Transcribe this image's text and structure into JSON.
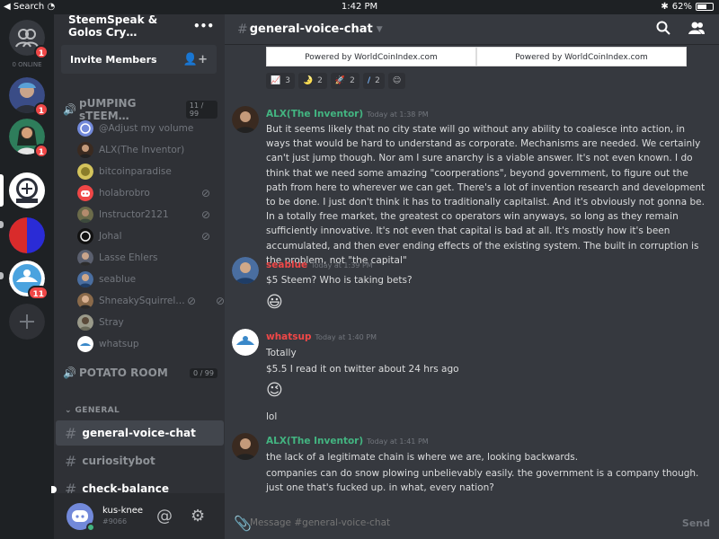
{
  "statusbar": {
    "left": "Search",
    "time": "1:42 PM",
    "battery": "62%",
    "battery_level": 0.62
  },
  "rail": {
    "online_label": "0 ONLINE",
    "badges": [
      "1",
      "1",
      "1",
      "11"
    ],
    "add_label": "+"
  },
  "guild": {
    "name": "SteemSpeak & Golos Cry…",
    "more": "•••"
  },
  "invite": {
    "label": "Invite Members"
  },
  "voice_channels": [
    {
      "name": "pUMPING sTEEM…",
      "limit": "11 / 99",
      "users": [
        "@Adjust my volume",
        "ALX(The Inventor)",
        "bitcoinparadise",
        "holabrobro",
        "Instructor2121",
        "Johal",
        "Lasse Ehlers",
        "seablue",
        "ShneakySquirrel…",
        "Stray",
        "whatsup"
      ]
    },
    {
      "name": "POTATO ROOM",
      "limit": "0 / 99"
    }
  ],
  "category": "GENERAL",
  "text_channels": [
    "general-voice-chat",
    "curiositybot",
    "check-balance"
  ],
  "user": {
    "name": "kus-knee",
    "tag": "#9066"
  },
  "chat": {
    "channel": "general-voice-chat",
    "embeds": [
      "Powered by WorldCoinIndex.com",
      "Powered by WorldCoinIndex.com"
    ],
    "reactions": [
      {
        "emoji": "📈",
        "count": "3"
      },
      {
        "emoji": "🌛",
        "count": "2"
      },
      {
        "emoji": "🚀",
        "count": "2"
      },
      {
        "emoji": "/",
        "count": "2"
      }
    ],
    "messages": [
      {
        "author": "ALX(The Inventor)",
        "color": "#43b581",
        "time": "Today at 1:38 PM",
        "text": "But it seems likely that no city state will go without any ability to coalesce into action, in ways that would be hard to understand as corporate. Mechanisms are needed. We certainly can't just jump though. Nor am I sure anarchy is a viable answer. It's not even known. I do think that we need some amazing \"coorperations\", beyond government, to figure out the path from here to wherever we can get. There's a lot of invention research and development to be done. I just don't think it has to traditionally capitalist. And it's obviously not gonna be. In a totally free market, the greatest co operators win anyways, so long as they remain sufficiently innovative. It's not even that capital is bad at all. It's mostly how it's been accumulated, and then ever ending effects of the existing system. The built in corruption is the problem, not \"the capital\""
      },
      {
        "author": "seablue",
        "color": "#f04747",
        "time": "Today at 1:39 PM",
        "text": "$5 Steem?  Who is taking bets?",
        "emoji": "😃"
      },
      {
        "author": "whatsup",
        "color": "#f04747",
        "time": "Today at 1:40 PM",
        "lines": [
          "Totally",
          "$5.5  I read it on twitter about 24 hrs ago",
          "lol"
        ],
        "emoji": "😉"
      },
      {
        "author": "ALX(The Inventor)",
        "color": "#43b581",
        "time": "Today at 1:41 PM",
        "lines": [
          "the lack of a legitimate chain is where we are, looking backwards.",
          "companies can do snow plowing unbelievably easily. the government is a company though. just one that's fucked up. in what, every nation?"
        ]
      }
    ],
    "input_placeholder": "Message #general-voice-chat",
    "send_label": "Send"
  },
  "colors": {
    "accent": "#7289da",
    "online": "#43b581",
    "alert": "#f04747"
  }
}
